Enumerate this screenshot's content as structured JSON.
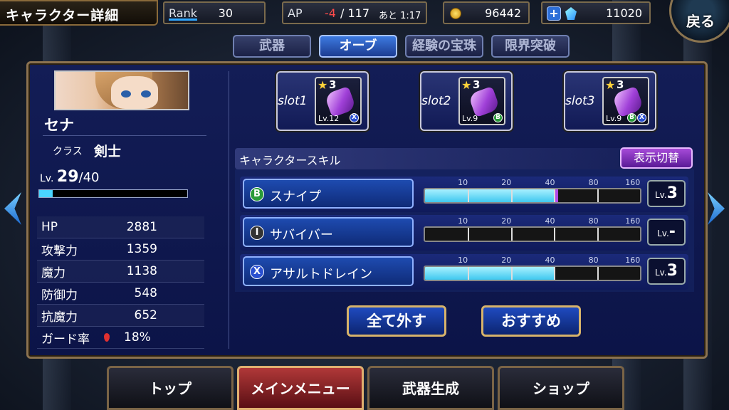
{
  "header": {
    "title": "キャラクター詳細",
    "rank_label": "Rank",
    "rank_value": "30",
    "ap_label": "AP",
    "ap_current": "-4",
    "ap_max": "/ 117",
    "ap_timer": "あと 1:17",
    "gil": "96442",
    "gems": "11020",
    "back_label": "戻る"
  },
  "tabs": [
    {
      "label": "武器"
    },
    {
      "label": "オーブ"
    },
    {
      "label": "経験の宝珠"
    },
    {
      "label": "限界突破"
    }
  ],
  "character": {
    "name": "セナ",
    "class_label": "クラス",
    "class_value": "剣士",
    "level_prefix": "Lv.",
    "level": "29",
    "level_max": "/40",
    "exp_progress": 0.09
  },
  "stats": [
    {
      "label": "HP",
      "value": "2881"
    },
    {
      "label": "攻撃力",
      "value": "1359"
    },
    {
      "label": "魔力",
      "value": "1138"
    },
    {
      "label": "防御力",
      "value": "548"
    },
    {
      "label": "抗魔力",
      "value": "652"
    },
    {
      "label": "ガード率",
      "value": "18%"
    }
  ],
  "slots": [
    {
      "label": "slot1",
      "stars": "3",
      "level": "Lv.12",
      "badges": [
        "X"
      ]
    },
    {
      "label": "slot2",
      "stars": "3",
      "level": "Lv.9",
      "badges": [
        "B"
      ]
    },
    {
      "label": "slot3",
      "stars": "3",
      "level": "Lv.9",
      "badges": [
        "B",
        "X"
      ]
    }
  ],
  "skills": {
    "header": "キャラクタースキル",
    "toggle_label": "表示切替",
    "tick_labels": [
      "10",
      "20",
      "40",
      "80",
      "160"
    ],
    "items": [
      {
        "icon": "B",
        "name": "スナイプ",
        "lv_prefix": "Lv.",
        "lv": "3",
        "progress": 0.6,
        "pending": 0.02
      },
      {
        "icon": "I",
        "name": "サバイバー",
        "lv_prefix": "Lv.",
        "lv": "-",
        "progress": 0,
        "pending": 0
      },
      {
        "icon": "X",
        "name": "アサルトドレイン",
        "lv_prefix": "Lv.",
        "lv": "3",
        "progress": 0.6,
        "pending": 0
      }
    ]
  },
  "actions": {
    "remove_all": "全て外す",
    "recommend": "おすすめ"
  },
  "nav": [
    {
      "label": "トップ"
    },
    {
      "label": "メインメニュー"
    },
    {
      "label": "武器生成"
    },
    {
      "label": "ショップ"
    }
  ],
  "colors": {
    "accent_gold": "#8b7250",
    "panel": "#131d56",
    "bar_fill": "#3fc8ef",
    "pending": "#b04ae8"
  }
}
